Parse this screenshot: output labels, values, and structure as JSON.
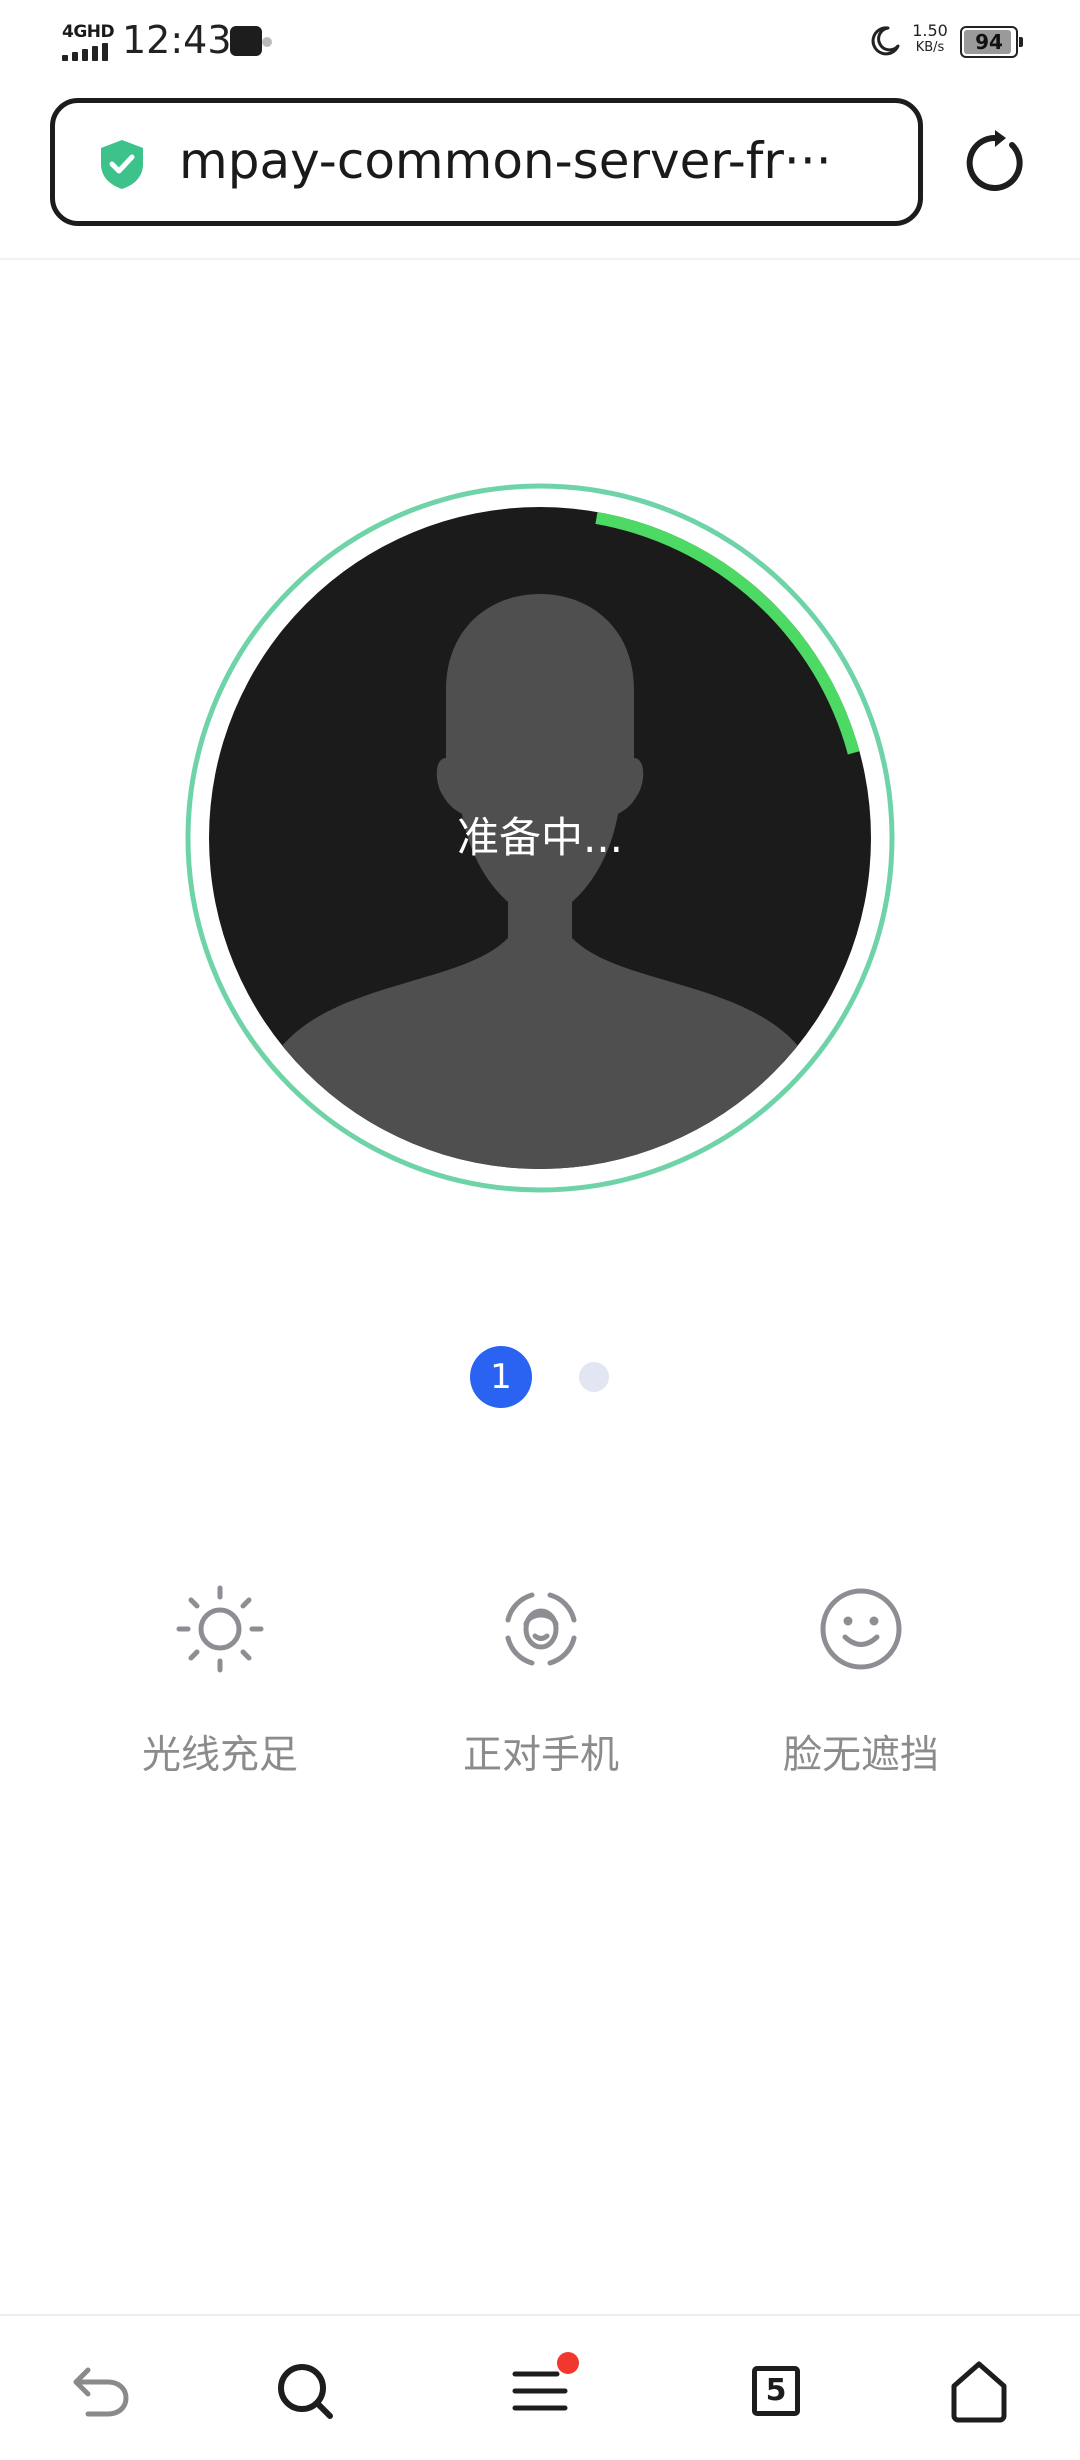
{
  "status_bar": {
    "network": "4GHD",
    "time": "12:43",
    "speed_value": "1.50",
    "speed_unit": "KB/s",
    "battery": "94",
    "battery_level_percent": 94
  },
  "address_bar": {
    "url": "mpay-common-server-fr···",
    "security_icon": "shield-check-icon",
    "refresh_icon": "refresh-icon"
  },
  "face_scan": {
    "status_text": "准备中...",
    "progress_fraction": 0.18,
    "colors": {
      "ring": "#6fd3a8",
      "progress": "#4cd964",
      "background": "#1b1b1b",
      "silhouette": "#4f4f4f"
    }
  },
  "steps": {
    "current": "1",
    "total": 2,
    "active_color": "#2a63f2"
  },
  "tips": [
    {
      "icon": "sun-icon",
      "label": "光线充足"
    },
    {
      "icon": "face-frame-icon",
      "label": "正对手机"
    },
    {
      "icon": "smile-icon",
      "label": "脸无遮挡"
    }
  ],
  "bottom_nav": {
    "tabs_count": "5",
    "icons": [
      "back-icon",
      "search-icon",
      "menu-icon",
      "tabs-icon",
      "home-icon"
    ],
    "menu_badge_color": "#f0382f"
  }
}
